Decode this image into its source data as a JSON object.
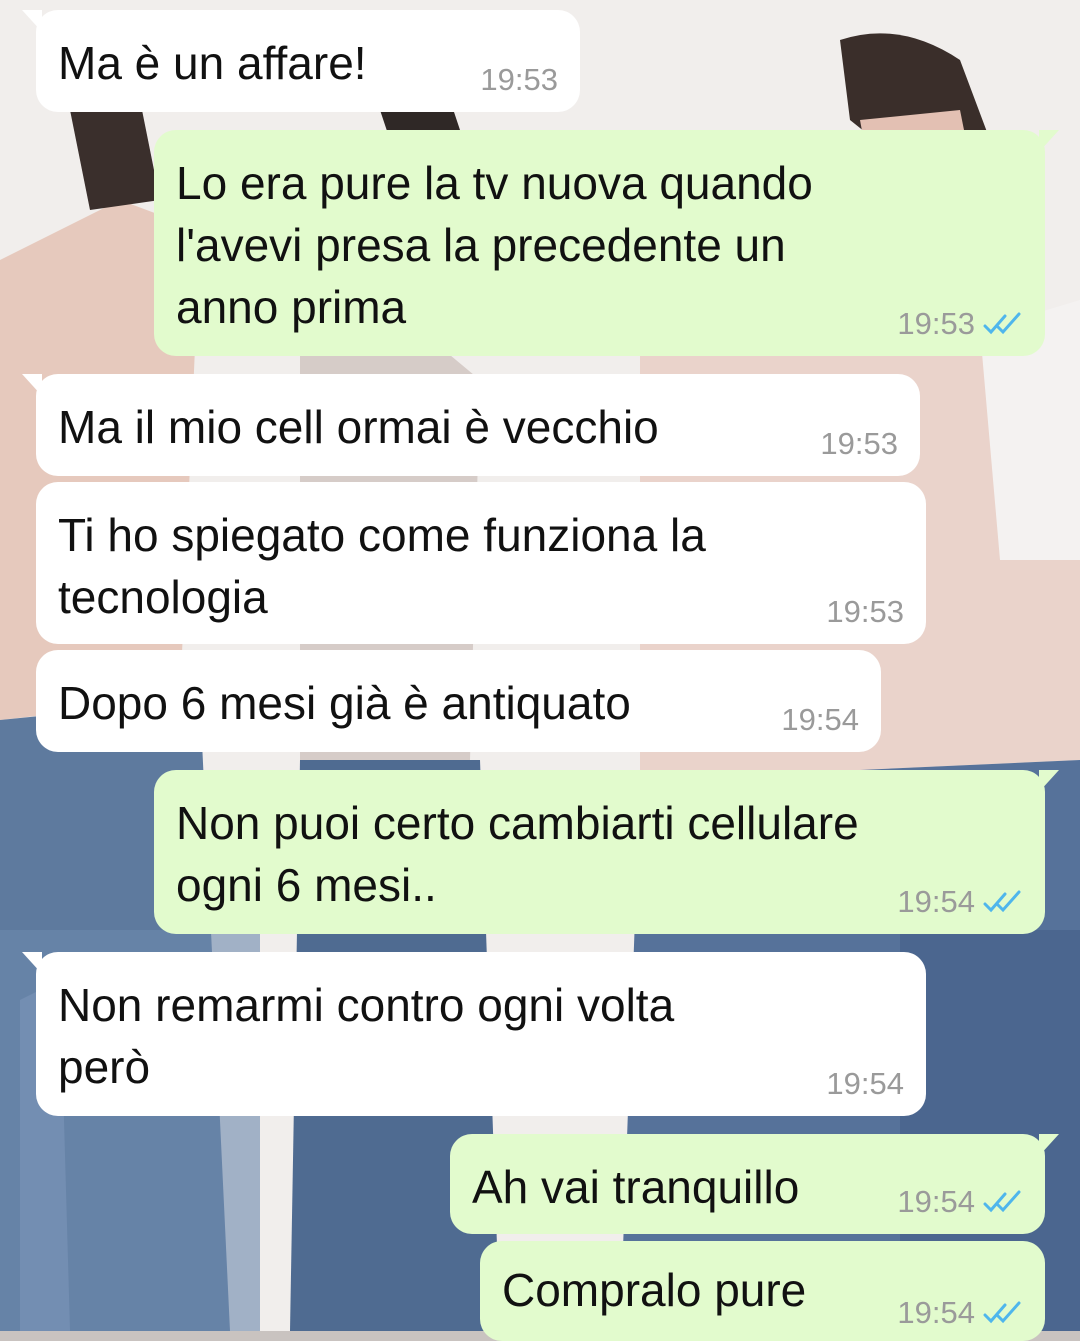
{
  "colors": {
    "incoming_bubble": "#ffffff",
    "outgoing_bubble": "#e2fbcd",
    "timestamp": "#9a9a9a",
    "read_ticks": "#4fb6ec"
  },
  "messages": [
    {
      "direction": "in",
      "text": "Ma è un affare!",
      "time": "19:53"
    },
    {
      "direction": "out",
      "text": "Lo era pure la tv nuova quando l'avevi presa la precedente un anno prima",
      "time": "19:53",
      "status": "read-ticks-icon"
    },
    {
      "direction": "in",
      "text": "Ma il mio cell ormai è vecchio",
      "time": "19:53"
    },
    {
      "direction": "in",
      "text": "Ti ho spiegato come funziona la tecnologia",
      "time": "19:53"
    },
    {
      "direction": "in",
      "text": "Dopo 6 mesi già è antiquato",
      "time": "19:54"
    },
    {
      "direction": "out",
      "text": "Non puoi certo cambiarti cellulare ogni 6 mesi..",
      "time": "19:54",
      "status": "read-ticks-icon"
    },
    {
      "direction": "in",
      "text": "Non remarmi contro ogni volta però",
      "time": "19:54"
    },
    {
      "direction": "out",
      "text": "Ah vai tranquillo",
      "time": "19:54",
      "status": "read-ticks-icon"
    },
    {
      "direction": "out",
      "text": "Compralo pure",
      "time": "19:54",
      "status": "read-ticks-icon"
    }
  ]
}
